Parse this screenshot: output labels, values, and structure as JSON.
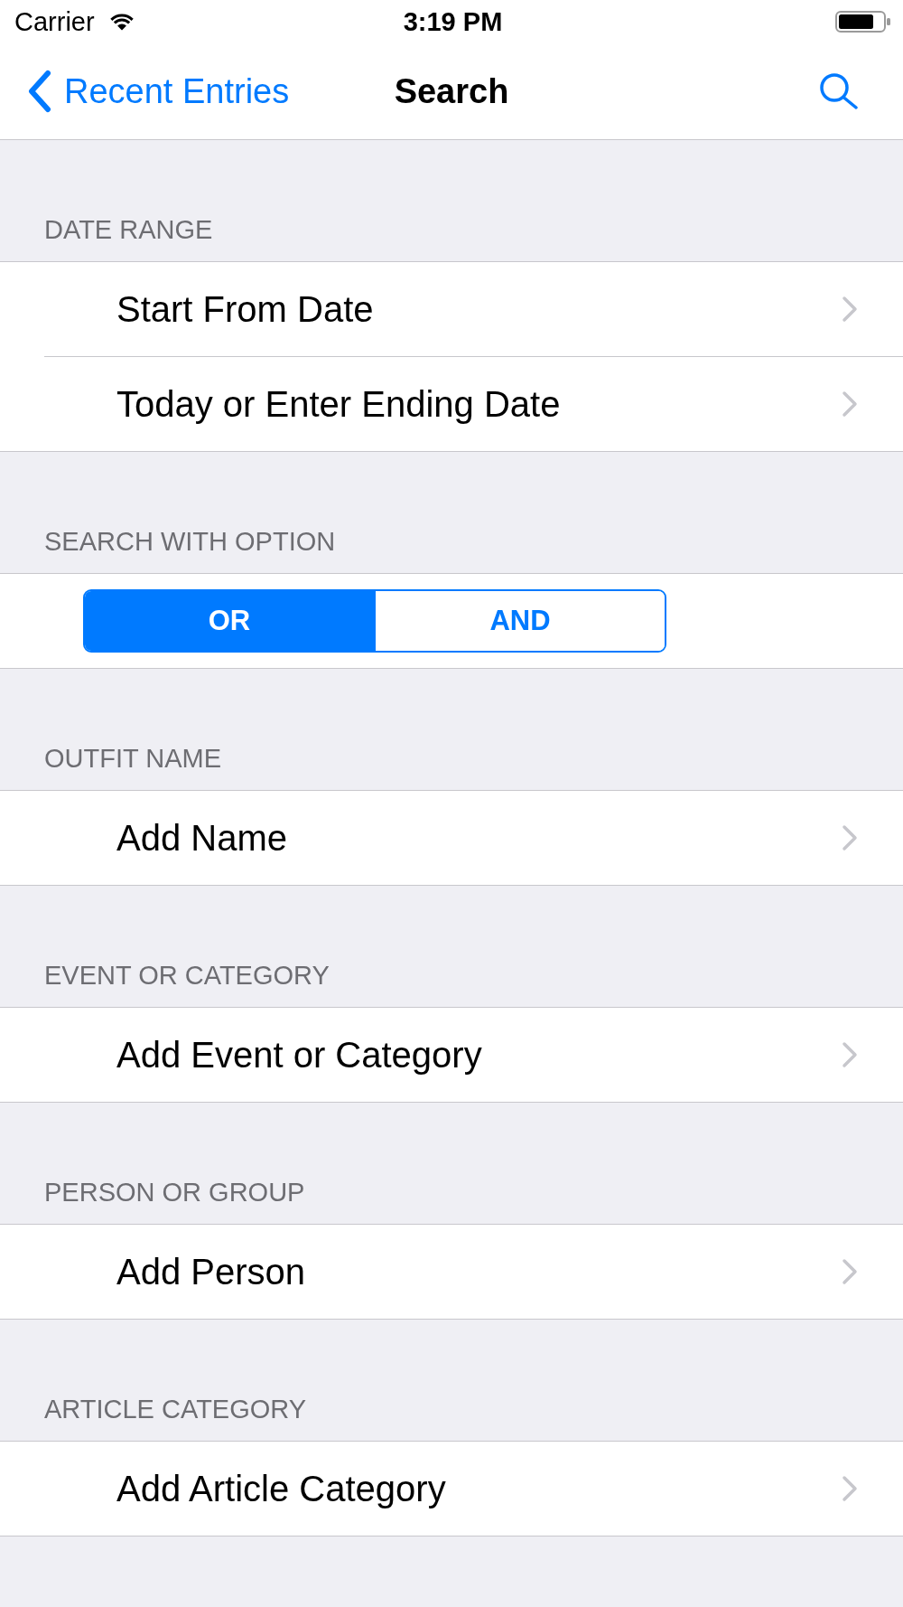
{
  "status_bar": {
    "carrier": "Carrier",
    "time": "3:19 PM"
  },
  "nav_bar": {
    "back_label": "Recent Entries",
    "title": "Search"
  },
  "sections": [
    {
      "header": "DATE RANGE",
      "kind": "rows",
      "rows": [
        {
          "label": "Start From Date"
        },
        {
          "label": "Today or Enter Ending Date"
        }
      ]
    },
    {
      "header": "SEARCH WITH OPTION",
      "kind": "segmented",
      "segments": [
        {
          "label": "OR",
          "selected": true
        },
        {
          "label": "AND",
          "selected": false
        }
      ]
    },
    {
      "header": "OUTFIT NAME",
      "kind": "rows",
      "rows": [
        {
          "label": "Add Name"
        }
      ]
    },
    {
      "header": "EVENT OR CATEGORY",
      "kind": "rows",
      "rows": [
        {
          "label": "Add Event or Category"
        }
      ]
    },
    {
      "header": "PERSON OR GROUP",
      "kind": "rows",
      "rows": [
        {
          "label": "Add Person"
        }
      ]
    },
    {
      "header": "ARTICLE CATEGORY",
      "kind": "rows",
      "rows": [
        {
          "label": "Add Article Category"
        }
      ]
    }
  ]
}
